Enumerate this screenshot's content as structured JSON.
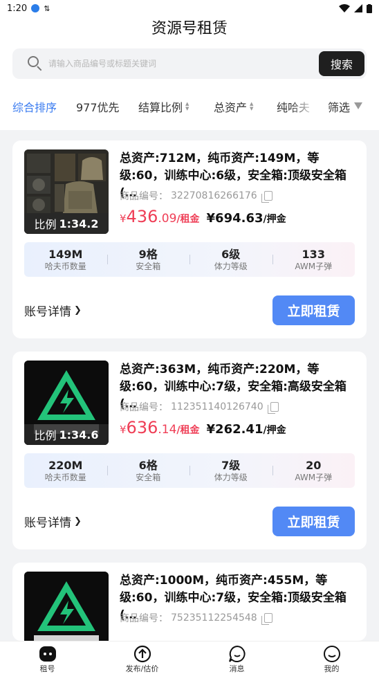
{
  "status": {
    "time": "1:20",
    "left_extra": "↕"
  },
  "header": {
    "title": "资源号租赁",
    "search_placeholder": "请输入商品编号或标题关键词",
    "search_button": "搜索"
  },
  "sort": {
    "items": [
      "综合排序",
      "977优先",
      "结算比例",
      "总资产",
      "纯哈夫",
      "筛选"
    ]
  },
  "listings": [
    {
      "title": "总资产:712M，纯币资产:149M，等级:60，训练中心:6级，安全箱:顶级安全箱(…",
      "code_label": "商品编号：",
      "code": "32270816266176",
      "ratio_label": "比例",
      "ratio": "1:34.2",
      "currency": "¥",
      "price_int": "436",
      "price_dec": ".09",
      "price_unit": "/租金",
      "deposit": "¥694.63",
      "deposit_unit": "/押金",
      "stats": [
        {
          "value": "149M",
          "label": "哈夫币数量"
        },
        {
          "value": "9格",
          "label": "安全箱"
        },
        {
          "value": "6级",
          "label": "体力等级"
        },
        {
          "value": "133",
          "label": "AWM子弹"
        }
      ],
      "detail": "账号详情",
      "rent": "立即租赁"
    },
    {
      "title": "总资产:363M，纯币资产:220M，等级:60，训练中心:7级，安全箱:高级安全箱(…",
      "code_label": "商品编号：",
      "code": "112351140126740",
      "ratio_label": "比例",
      "ratio": "1:34.6",
      "currency": "¥",
      "price_int": "636",
      "price_dec": ".14",
      "price_unit": "/租金",
      "deposit": "¥262.41",
      "deposit_unit": "/押金",
      "stats": [
        {
          "value": "220M",
          "label": "哈夫币数量"
        },
        {
          "value": "6格",
          "label": "安全箱"
        },
        {
          "value": "7级",
          "label": "体力等级"
        },
        {
          "value": "20",
          "label": "AWM子弹"
        }
      ],
      "detail": "账号详情",
      "rent": "立即租赁"
    },
    {
      "title": "总资产:1000M，纯币资产:455M，等级:60，训练中心:7级，安全箱:顶级安全箱(…",
      "code_label": "商品编号：",
      "code": "75235112254548"
    }
  ],
  "tabbar": {
    "items": [
      "租号",
      "发布/估价",
      "消息",
      "我的"
    ]
  },
  "colors": {
    "accent": "#3a7bf0",
    "price": "#ef3e56",
    "button": "#5289f5"
  }
}
